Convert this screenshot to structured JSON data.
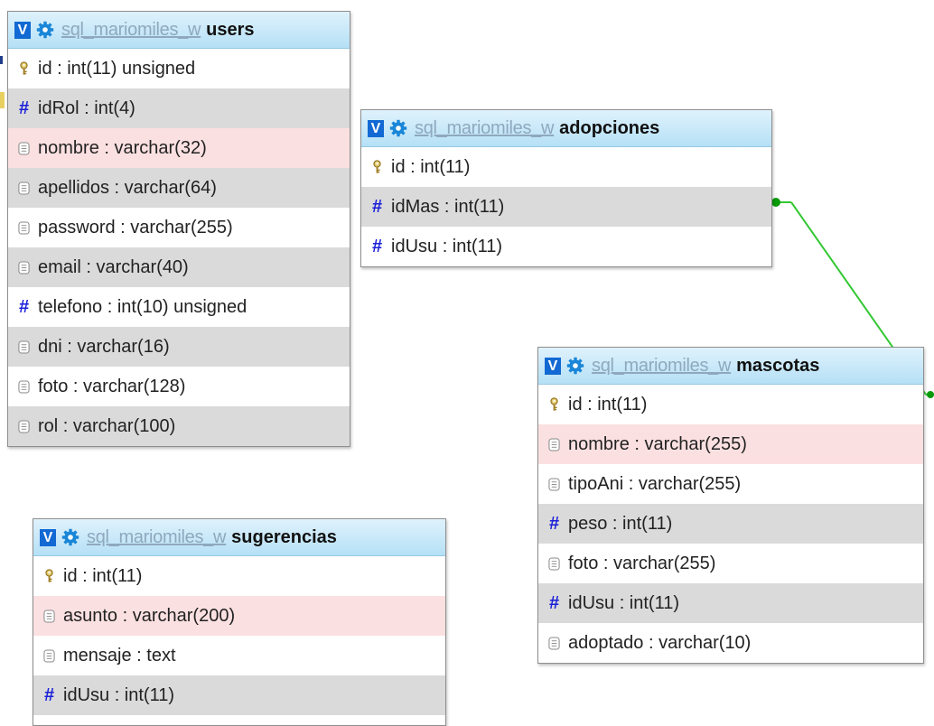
{
  "database": "sql_mariomiles_w",
  "colors": {
    "header_top": "#dff2fc",
    "header_bottom": "#b5e0f6",
    "toggle_button": "#1269d3",
    "relation_line": "#32c832",
    "row_alt": "#dadada",
    "row_highlight": "#fbe0e1",
    "numeric_icon": "#1a1fd8"
  },
  "tables": {
    "users": {
      "toggle": "V",
      "name": "users",
      "columns": [
        {
          "icon": "key-icon",
          "label": "id : int(11) unsigned"
        },
        {
          "icon": "hash-icon",
          "label": "idRol : int(4)"
        },
        {
          "icon": "text-field-icon",
          "label": "nombre : varchar(32)"
        },
        {
          "icon": "text-field-icon",
          "label": "apellidos : varchar(64)"
        },
        {
          "icon": "text-field-icon",
          "label": "password : varchar(255)"
        },
        {
          "icon": "text-field-icon",
          "label": "email : varchar(40)"
        },
        {
          "icon": "hash-icon",
          "label": "telefono : int(10) unsigned"
        },
        {
          "icon": "text-field-icon",
          "label": "dni : varchar(16)"
        },
        {
          "icon": "text-field-icon",
          "label": "foto : varchar(128)"
        },
        {
          "icon": "text-field-icon",
          "label": "rol : varchar(100)"
        }
      ]
    },
    "adopciones": {
      "toggle": "V",
      "name": "adopciones",
      "columns": [
        {
          "icon": "key-icon",
          "label": "id : int(11)"
        },
        {
          "icon": "hash-icon",
          "label": "idMas : int(11)"
        },
        {
          "icon": "hash-icon",
          "label": "idUsu : int(11)"
        }
      ]
    },
    "mascotas": {
      "toggle": "V",
      "name": "mascotas",
      "columns": [
        {
          "icon": "key-icon",
          "label": "id : int(11)"
        },
        {
          "icon": "text-field-icon",
          "label": "nombre : varchar(255)"
        },
        {
          "icon": "text-field-icon",
          "label": "tipoAni : varchar(255)"
        },
        {
          "icon": "hash-icon",
          "label": "peso : int(11)"
        },
        {
          "icon": "text-field-icon",
          "label": "foto : varchar(255)"
        },
        {
          "icon": "hash-icon",
          "label": "idUsu : int(11)"
        },
        {
          "icon": "text-field-icon",
          "label": "adoptado : varchar(10)"
        }
      ]
    },
    "sugerencias": {
      "toggle": "V",
      "name": "sugerencias",
      "columns": [
        {
          "icon": "key-icon",
          "label": "id : int(11)"
        },
        {
          "icon": "text-field-icon",
          "label": "asunto : varchar(200)"
        },
        {
          "icon": "text-field-icon",
          "label": "mensaje : text"
        },
        {
          "icon": "hash-icon",
          "label": "idUsu : int(11)"
        }
      ]
    }
  },
  "relations": [
    {
      "from": "adopciones.idMas",
      "to": "mascotas.id"
    }
  ]
}
